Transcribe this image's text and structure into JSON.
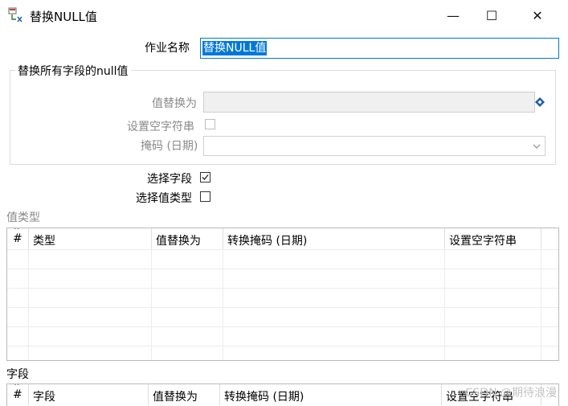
{
  "window": {
    "title": "替换NULL值",
    "minimize_glyph": "—",
    "maximize_glyph": "☐",
    "close_glyph": "✕"
  },
  "form": {
    "job_name_label": "作业名称",
    "job_name_value": "替换NULL值",
    "group_title": "替换所有字段的null值",
    "replace_with_label": "值替换为",
    "replace_with_value": "",
    "set_empty_label": "设置空字符串",
    "mask_label": "掩码 (日期)",
    "mask_value": "",
    "select_fields_label": "选择字段",
    "select_fields_checked": true,
    "select_value_type_label": "选择值类型",
    "select_value_type_checked": false
  },
  "value_type_table": {
    "section_label": "值类型",
    "columns": [
      "#",
      "类型",
      "值替换为",
      "转换掩码 (日期)",
      "设置空字符串"
    ]
  },
  "fields_table": {
    "section_label": "字段",
    "columns": [
      "#",
      "字段",
      "值替换为",
      "转换掩码 (日期)",
      "设置空字符串"
    ]
  },
  "watermark": "CSDN @期待浪漫",
  "icons": {
    "app": "transform-icon",
    "variable": "variable-diamond-icon",
    "dropdown": "chevron-down-icon"
  },
  "colors": {
    "accent": "#0078d7",
    "disabled_text": "#8a8a8a",
    "variable_icon": "#1e5fa8"
  }
}
